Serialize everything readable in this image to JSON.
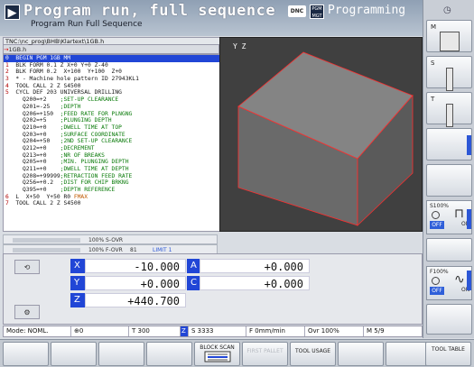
{
  "header": {
    "title": "Program run, full sequence",
    "subtitle": "Program Run Full Sequence",
    "dnc": "DNC",
    "pgm_badge": "PGM MGT",
    "mode": "Programming"
  },
  "program": {
    "path": "TNC:\\nc_prog\\BHB\\Klartext\\1GB.h",
    "tab": "1GB.h",
    "lines": [
      {
        "n": "0",
        "t": "  BEGIN PGM 1GB MM",
        "sel": true
      },
      {
        "n": "1",
        "t": "  BLK FORM 0.1 Z X+0 Y+0 Z-40"
      },
      {
        "n": "2",
        "t": "  BLK FORM 0.2  X+100  Y+100  Z+0"
      },
      {
        "n": "3",
        "t": "  * - Machine hole pattern ID 27943KL1"
      },
      {
        "n": "4",
        "t": "  TOOL CALL 2 Z S4500"
      },
      {
        "n": "5",
        "t": "  CYCL DEF 203 UNIVERSAL DRILLING"
      },
      {
        "t": "     Q200=+2    ",
        "c": ";SET-UP CLEARANCE"
      },
      {
        "t": "     Q201=-25   ",
        "c": ";DEPTH"
      },
      {
        "t": "     Q206=+150  ",
        "c": ";FEED RATE FOR PLNGNG"
      },
      {
        "t": "     Q202=+5    ",
        "c": ";PLUNGING DEPTH"
      },
      {
        "t": "     Q210=+0    ",
        "c": ";DWELL TIME AT TOP"
      },
      {
        "t": "     Q203=+0    ",
        "c": ";SURFACE COORDINATE"
      },
      {
        "t": "     Q204=+50   ",
        "c": ";2ND SET-UP CLEARANCE"
      },
      {
        "t": "     Q212=+0    ",
        "c": ";DECREMENT"
      },
      {
        "t": "     Q213=+0    ",
        "c": ";NR OF BREAKS"
      },
      {
        "t": "     Q205=+0    ",
        "c": ";MIN. PLUNGING DEPTH"
      },
      {
        "t": "     Q211=+0    ",
        "c": ";DWELL TIME AT DEPTH"
      },
      {
        "t": "     Q208=+99999",
        "c": ";RETRACTION FEED RATE"
      },
      {
        "t": "     Q256=+0.2  ",
        "c": ";DIST FOR CHIP BRKNG"
      },
      {
        "t": "     Q395=+0    ",
        "c": ";DEPTH REFERENCE"
      },
      {
        "n": "6",
        "t": "  L  X+50  Y+50 R0 ",
        "k": "FMAX"
      },
      {
        "n": "7",
        "t": "  TOOL CALL 2 Z S4500"
      }
    ]
  },
  "view3d": {
    "axis_label": "Y Z"
  },
  "overrides": [
    {
      "label": "100% S-OVR",
      "extra": "",
      "limit": ""
    },
    {
      "label": "100% F-OVR",
      "extra": "81",
      "limit": "LIMIT 1"
    }
  ],
  "positions": [
    {
      "axis": "X",
      "value": "-10.000",
      "axis2": "A",
      "value2": "+0.000"
    },
    {
      "axis": "Y",
      "value": "+0.000",
      "axis2": "C",
      "value2": "+0.000"
    },
    {
      "axis": "Z",
      "value": "+440.700",
      "axis2": "",
      "value2": ""
    }
  ],
  "status": {
    "mode": "Mode: NOML.",
    "dial": "0",
    "tool": "T 300",
    "z": "Z",
    "spindle": "S 3333",
    "feed": "F 0mm/min",
    "ovr": "Ovr 100%",
    "m": "M 5/9"
  },
  "sidebar": {
    "keys": [
      {
        "letter": "M"
      },
      {
        "letter": "S"
      },
      {
        "letter": "T"
      }
    ],
    "spindle_ovr": {
      "title": "S100%",
      "off": "OFF",
      "on": "ON"
    },
    "feed_ovr": {
      "title": "F100%",
      "off": "OFF",
      "on": "ON"
    }
  },
  "softkeys": {
    "block_scan": "BLOCK SCAN",
    "first_pallet": "FIRST PALLET",
    "tool_usage": "TOOL USAGE",
    "tool_table": "TOOL TABLE"
  },
  "colors": {
    "accent": "#2146d6",
    "header": "#8fa0b4",
    "view_bg": "#404040"
  }
}
